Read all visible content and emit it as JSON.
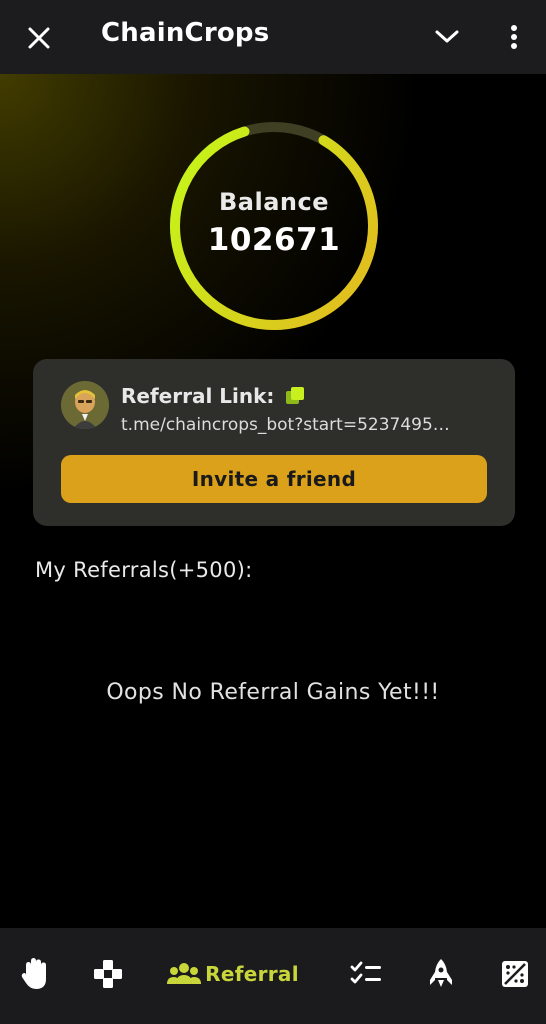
{
  "app": {
    "title": "ChainCrops"
  },
  "balance": {
    "label": "Balance",
    "value": "102671",
    "ring_color_start": "#c7ef1a",
    "ring_color_end": "#e3c21f",
    "ring_track_color": "#4a4a2a"
  },
  "referral": {
    "title": "Referral Link:",
    "link": "t.me/chaincrops_bot?start=5237495…",
    "invite_label": "Invite a friend",
    "accent": "#dba11b"
  },
  "referrals": {
    "heading": "My Referrals(+500):",
    "empty_message": "Oops No Referral Gains Yet!!!"
  },
  "nav": {
    "items": [
      {
        "icon": "hand-icon",
        "label": ""
      },
      {
        "icon": "gamepad-icon",
        "label": ""
      },
      {
        "icon": "people-icon",
        "label": "Referral",
        "active": true
      },
      {
        "icon": "tasks-icon",
        "label": ""
      },
      {
        "icon": "rocket-icon",
        "label": ""
      },
      {
        "icon": "grid-dice-icon",
        "label": ""
      }
    ],
    "active_color": "#c9d63a"
  }
}
